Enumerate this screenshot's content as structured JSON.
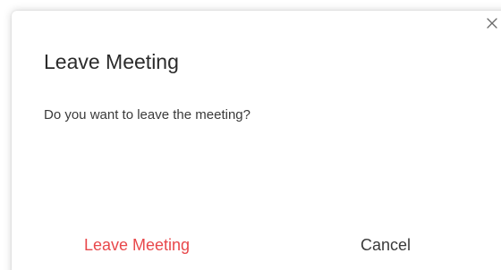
{
  "dialog": {
    "title": "Leave Meeting",
    "message": "Do you want to leave the meeting?",
    "close_icon": "close-icon",
    "buttons": {
      "leave_label": "Leave Meeting",
      "cancel_label": "Cancel"
    }
  },
  "colors": {
    "danger": "#e8484b",
    "text": "#3a3a3a",
    "close_icon": "#6a6a6a"
  }
}
